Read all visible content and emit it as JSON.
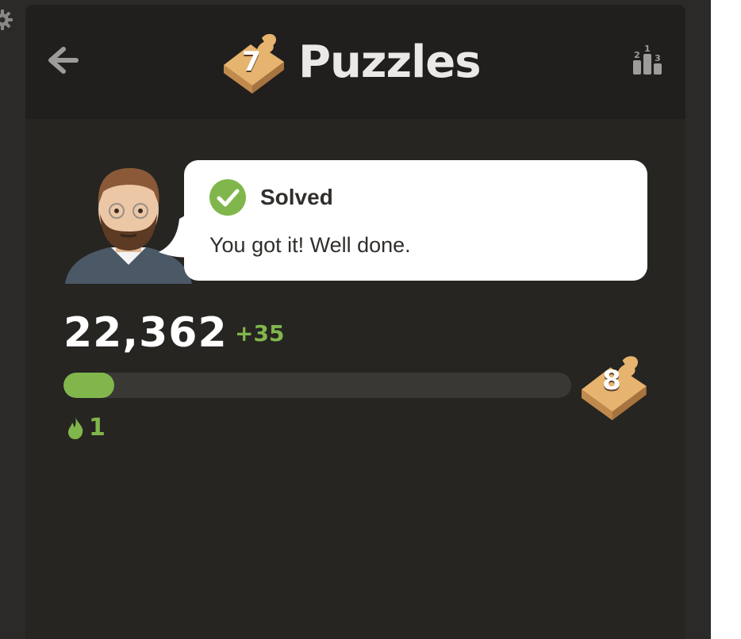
{
  "header": {
    "title": "Puzzles",
    "level_badge": "7",
    "back_icon": "arrow-left-icon",
    "leaderboard_icon": "podium-icon"
  },
  "feedback": {
    "status": "Solved",
    "message": "You got it! Well done."
  },
  "stats": {
    "rating": "22,362",
    "rating_change": "+35",
    "progress_fraction": 0.1,
    "next_level": "8",
    "streak": "1"
  },
  "colors": {
    "accent_green": "#81b64c",
    "panel_bg": "#262522",
    "header_bg": "#211f1d",
    "badge_tan": "#e6b46e"
  }
}
